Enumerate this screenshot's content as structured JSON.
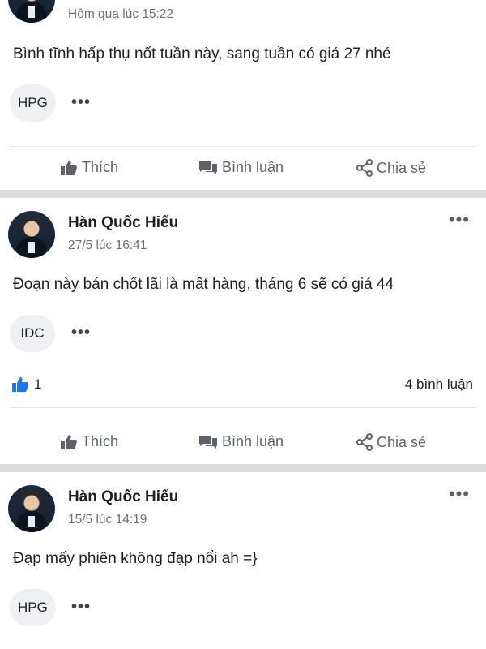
{
  "posts": [
    {
      "timestamp": "Hôm qua lúc 15:22",
      "content": "Bình tĩnh hấp thụ nốt tuần này, sang tuần có giá 27 nhé",
      "tag": "HPG",
      "tag_more": "•••"
    },
    {
      "author": "Hàn Quốc Hiếu",
      "timestamp": "27/5 lúc 16:41",
      "more": "•••",
      "content": "Đoạn này bán chốt lãi là mất hàng, tháng 6 sẽ có giá 44",
      "tag": "IDC",
      "tag_more": "•••",
      "like_count": "1",
      "comment_count": "4 bình luận"
    },
    {
      "author": "Hàn Quốc Hiếu",
      "timestamp": "15/5 lúc 14:19",
      "more": "•••",
      "content": "Đạp mấy phiên không đạp nổi ah =}",
      "tag": "HPG",
      "tag_more": "•••"
    }
  ],
  "actions": {
    "like": "Thích",
    "comment": "Bình luận",
    "share": "Chia sẻ"
  },
  "colors": {
    "separator": "#dcdcdc",
    "action_text": "#5f6368",
    "like_blue": "#1877f2"
  }
}
